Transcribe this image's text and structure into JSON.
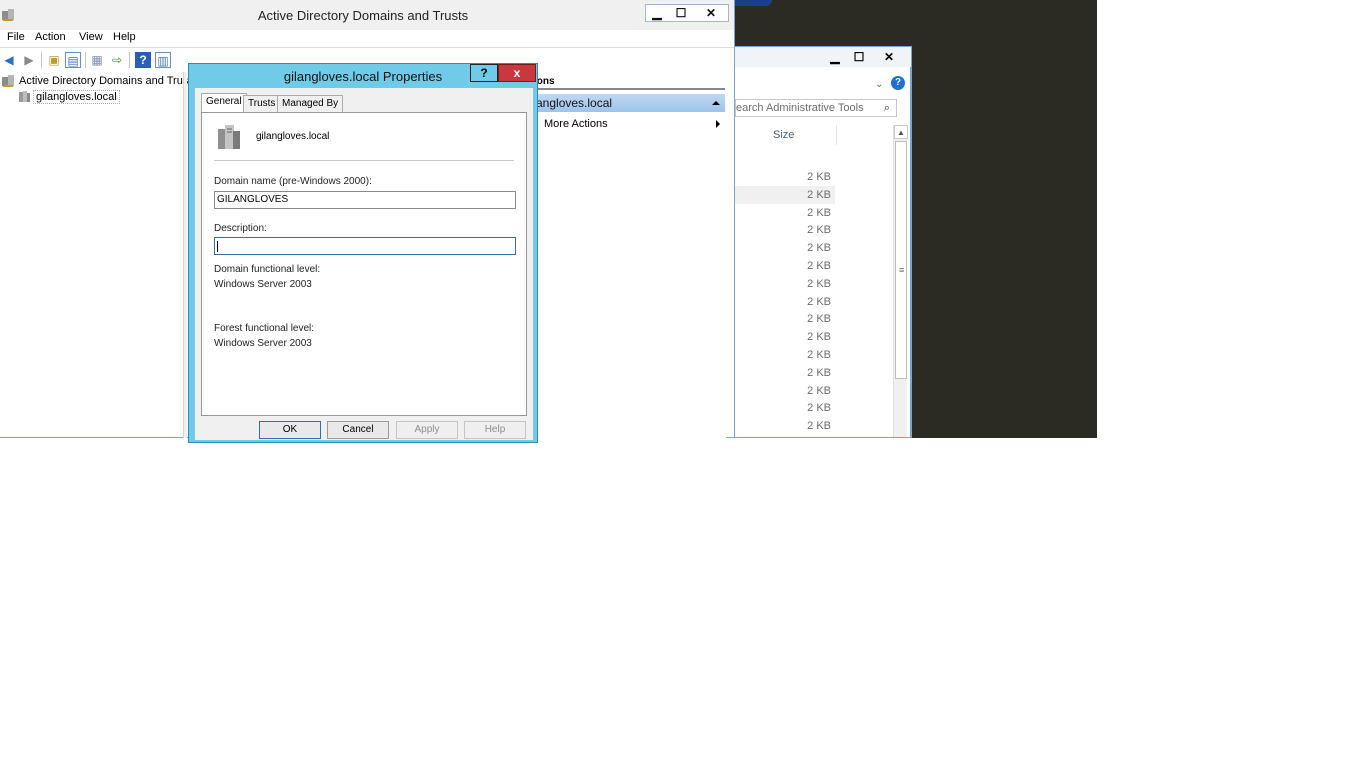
{
  "ad_window": {
    "title": "Active Directory Domains and Trusts",
    "controls": {
      "minimize": "▁",
      "maximize": "☐",
      "close": "✕"
    },
    "menu": [
      "File",
      "Action",
      "View",
      "Help"
    ],
    "tree": {
      "root": "Active Directory Domains and Trust",
      "child": "gilangloves.local"
    },
    "actions": {
      "header": "ions",
      "domain": "angloves.local",
      "more": "More Actions"
    }
  },
  "explorer": {
    "search_placeholder": "earch Administrative Tools",
    "column_size": "Size",
    "sizes": [
      "2 KB",
      "2 KB",
      "2 KB",
      "2 KB",
      "2 KB",
      "2 KB",
      "2 KB",
      "2 KB",
      "2 KB",
      "2 KB",
      "2 KB",
      "2 KB",
      "2 KB",
      "2 KB",
      "2 KB"
    ]
  },
  "dialog": {
    "title": "gilangloves.local Properties",
    "help_btn": "?",
    "close_btn": "x",
    "tabs": [
      "General",
      "Trusts",
      "Managed By"
    ],
    "active_tab": "General",
    "domain_display": "gilangloves.local",
    "prewin_label": "Domain name (pre-Windows 2000):",
    "prewin_value": "GILANGLOVES",
    "description_label": "Description:",
    "description_value": "",
    "dfl_label": "Domain functional level:",
    "dfl_value": "Windows Server 2003",
    "ffl_label": "Forest functional level:",
    "ffl_value": "Windows Server 2003",
    "buttons": {
      "ok": "OK",
      "cancel": "Cancel",
      "apply": "Apply",
      "help": "Help"
    }
  }
}
